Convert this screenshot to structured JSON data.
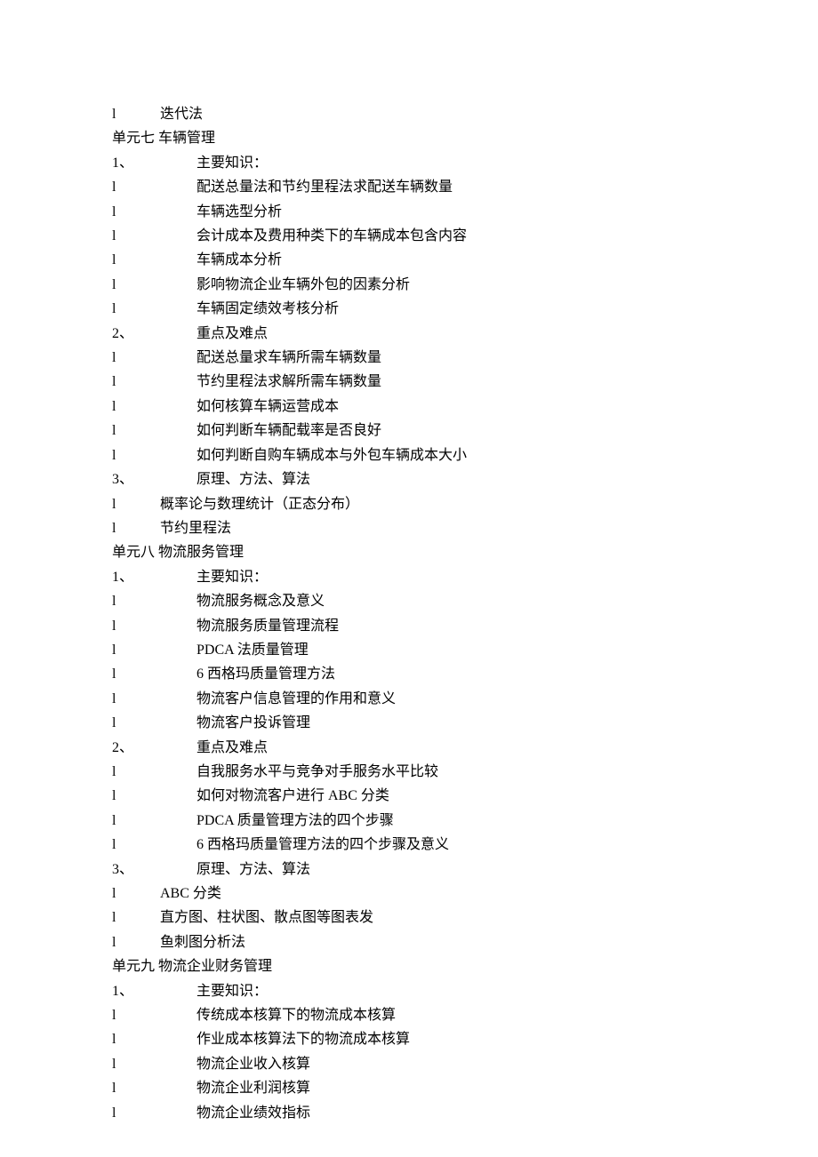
{
  "lines": [
    {
      "type": "bullet-short",
      "text": "迭代法"
    },
    {
      "type": "section",
      "text": "单元七 车辆管理"
    },
    {
      "type": "numbered",
      "num": "1、",
      "text": "主要知识："
    },
    {
      "type": "bullet-long",
      "text": "配送总量法和节约里程法求配送车辆数量"
    },
    {
      "type": "bullet-long",
      "text": "车辆选型分析"
    },
    {
      "type": "bullet-long",
      "text": "会计成本及费用种类下的车辆成本包含内容"
    },
    {
      "type": "bullet-long",
      "text": "车辆成本分析"
    },
    {
      "type": "bullet-long",
      "text": "影响物流企业车辆外包的因素分析"
    },
    {
      "type": "bullet-long",
      "text": "车辆固定绩效考核分析"
    },
    {
      "type": "numbered",
      "num": "2、",
      "text": "重点及难点"
    },
    {
      "type": "bullet-long",
      "text": "配送总量求车辆所需车辆数量"
    },
    {
      "type": "bullet-long",
      "text": "节约里程法求解所需车辆数量"
    },
    {
      "type": "bullet-long",
      "text": "如何核算车辆运营成本"
    },
    {
      "type": "bullet-long",
      "text": "如何判断车辆配载率是否良好"
    },
    {
      "type": "bullet-long",
      "text": "如何判断自购车辆成本与外包车辆成本大小"
    },
    {
      "type": "numbered",
      "num": "3、",
      "text": "原理、方法、算法"
    },
    {
      "type": "bullet-short",
      "text": "概率论与数理统计（正态分布）"
    },
    {
      "type": "bullet-short",
      "text": "节约里程法"
    },
    {
      "type": "section",
      "text": "单元八 物流服务管理"
    },
    {
      "type": "numbered",
      "num": "1、",
      "text": "主要知识："
    },
    {
      "type": "bullet-long",
      "text": "物流服务概念及意义"
    },
    {
      "type": "bullet-long",
      "text": "物流服务质量管理流程"
    },
    {
      "type": "bullet-long",
      "text": "PDCA 法质量管理"
    },
    {
      "type": "bullet-long",
      "text": "6 西格玛质量管理方法"
    },
    {
      "type": "bullet-long",
      "text": "物流客户信息管理的作用和意义"
    },
    {
      "type": "bullet-long",
      "text": "物流客户投诉管理"
    },
    {
      "type": "numbered",
      "num": "2、",
      "text": "重点及难点"
    },
    {
      "type": "bullet-long",
      "text": "自我服务水平与竞争对手服务水平比较"
    },
    {
      "type": "bullet-long",
      "text": "如何对物流客户进行 ABC 分类"
    },
    {
      "type": "bullet-long",
      "text": "PDCA 质量管理方法的四个步骤"
    },
    {
      "type": "bullet-long",
      "text": "6 西格玛质量管理方法的四个步骤及意义"
    },
    {
      "type": "numbered",
      "num": "3、",
      "text": "原理、方法、算法"
    },
    {
      "type": "bullet-short",
      "text": "ABC 分类"
    },
    {
      "type": "bullet-short",
      "text": "直方图、柱状图、散点图等图表发"
    },
    {
      "type": "bullet-short",
      "text": "鱼刺图分析法"
    },
    {
      "type": "section",
      "text": "单元九 物流企业财务管理"
    },
    {
      "type": "numbered",
      "num": "1、",
      "text": "主要知识："
    },
    {
      "type": "bullet-long",
      "text": "传统成本核算下的物流成本核算"
    },
    {
      "type": "bullet-long",
      "text": "作业成本核算法下的物流成本核算"
    },
    {
      "type": "bullet-long",
      "text": "物流企业收入核算"
    },
    {
      "type": "bullet-long",
      "text": "物流企业利润核算"
    },
    {
      "type": "bullet-long",
      "text": "物流企业绩效指标"
    }
  ]
}
